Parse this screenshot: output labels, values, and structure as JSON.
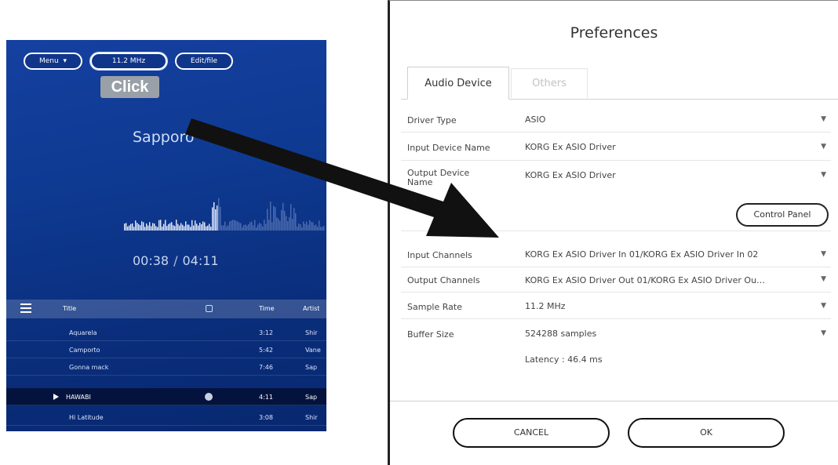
{
  "player": {
    "buttons": {
      "menu": "Menu",
      "rate": "11.2 MHz",
      "edit": "Edit/file"
    },
    "click_label": "Click",
    "track_title": "Sapporo",
    "elapsed": "00:38",
    "separator": "/",
    "total": "04:11",
    "columns": {
      "title": "Title",
      "time": "Time",
      "artist": "Artist"
    },
    "tracks": [
      {
        "title": "Aquarela",
        "time": "3:12",
        "artist": "Shir"
      },
      {
        "title": "Camporto",
        "time": "5:42",
        "artist": "Vane"
      },
      {
        "title": "Gonna mack",
        "time": "7:46",
        "artist": "Sap"
      },
      {
        "title": "HAWABI",
        "time": "4:11",
        "artist": "Sap"
      },
      {
        "title": "Hi Latitude",
        "time": "3:08",
        "artist": "Shir"
      }
    ],
    "active_track_index": 3
  },
  "preferences": {
    "title": "Preferences",
    "tabs": [
      {
        "label": "Audio Device",
        "active": true
      },
      {
        "label": "Others",
        "active": false
      }
    ],
    "settings": [
      {
        "label": "Driver Type",
        "value": "ASIO"
      },
      {
        "label": "Input Device Name",
        "value": "KORG Ex ASIO Driver"
      },
      {
        "label": "Output Device Name",
        "value": "KORG Ex ASIO Driver"
      },
      {
        "label": "Input Channels",
        "value": "KORG Ex ASIO Driver In 01/KORG Ex ASIO Driver In 02"
      },
      {
        "label": "Output Channels",
        "value": "KORG Ex ASIO Driver Out 01/KORG Ex ASIO Driver Ou…"
      },
      {
        "label": "Sample Rate",
        "value": "11.2 MHz"
      },
      {
        "label": "Buffer Size",
        "value": "524288 samples"
      }
    ],
    "control_panel_label": "Control Panel",
    "latency": "Latency : 46.4 ms",
    "cancel_label": "CANCEL",
    "ok_label": "OK",
    "dropdown_glyph": "▼"
  },
  "colors": {
    "player_bg": "#0e3a92",
    "active_row": "#04133e",
    "click_label_bg": "#9aa0a8",
    "arrow": "#111111"
  }
}
